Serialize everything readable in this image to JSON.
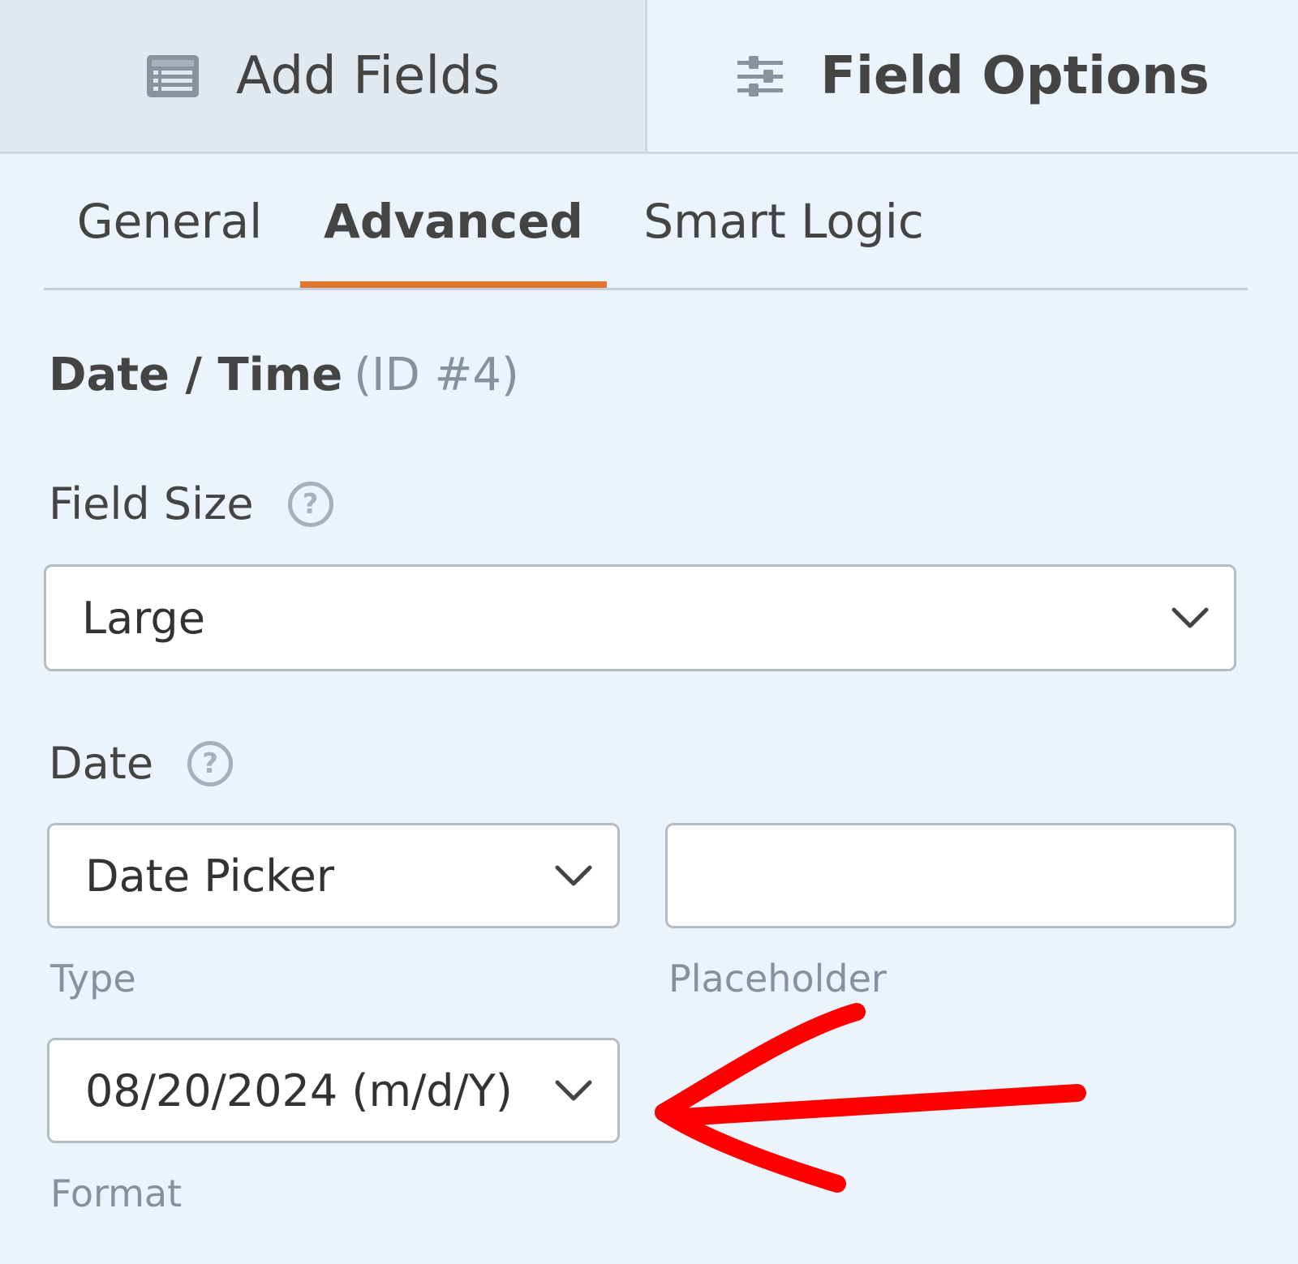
{
  "top_tabs": {
    "add_fields": "Add Fields",
    "field_options": "Field Options"
  },
  "sub_tabs": {
    "general": "General",
    "advanced": "Advanced",
    "smart_logic": "Smart Logic",
    "active": "advanced"
  },
  "field": {
    "name": "Date / Time",
    "id_text": "(ID #4)"
  },
  "field_size": {
    "label": "Field Size",
    "help_glyph": "?",
    "value": "Large"
  },
  "date": {
    "label": "Date",
    "help_glyph": "?",
    "type_value": "Date Picker",
    "type_caption": "Type",
    "placeholder_value": "",
    "placeholder_caption": "Placeholder",
    "format_value": "08/20/2024 (m/d/Y)",
    "format_caption": "Format"
  },
  "colors": {
    "accent": "#e27730",
    "annotation_arrow": "#ff0000",
    "background": "#ebf3fc"
  },
  "icons": {
    "add_fields": "list-form-icon",
    "field_options": "sliders-icon",
    "dropdown": "chevron-down-icon",
    "help": "help-circle-icon"
  }
}
